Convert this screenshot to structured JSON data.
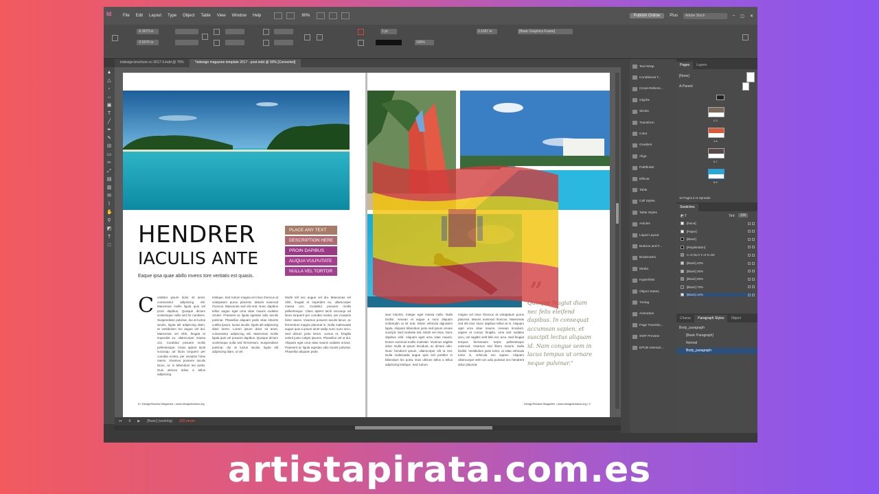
{
  "menubar": {
    "logo": "Id",
    "items": [
      "File",
      "Edit",
      "Layout",
      "Type",
      "Object",
      "Table",
      "View",
      "Window",
      "Help"
    ],
    "zoom": "90%",
    "publish_button": "Publish Online",
    "workspace": "Plus",
    "search_placeholder": "Adobe Stock"
  },
  "control": {
    "x_value": "-5.3073 in",
    "y_value": "-2.5076 in",
    "stroke_weight": "1 pt",
    "opacity": "100%",
    "ref_field": "0.1667 in",
    "frame_style": "[Basic Graphics Frame]"
  },
  "doc_tabs": [
    {
      "label": "indesign-brochure-cc-2017-3.indd @ 75%"
    },
    {
      "label": "*indesign magazine template 2017 - post.indd @ 90% [Converted]"
    }
  ],
  "article": {
    "headline": "HENDRER",
    "subhead": "IACULIS ANTE",
    "deck": "Eaque ipsa quae abillo invens tore veritatis est quasis.",
    "dropcap": "C",
    "tags": [
      {
        "label": "PLACE ANY TEXT",
        "color": "#a87a68"
      },
      {
        "label": "DESCRIPTION HERE",
        "color": "#b06a74"
      },
      {
        "label": "PROIN DAPIBUS",
        "color": "#9a3a86"
      },
      {
        "label": "ALIQUA VULPUTATE",
        "color": "#a63d8e"
      },
      {
        "label": "NULLA VEL TORTOR",
        "color": "#a33f90"
      }
    ],
    "col1": "urabitur ipsum dolor sit amet, consectetur adipiscing elit. Maecenas mollis ligula quis vel proin dapibus. Quisque dictum scelerisque nulla sed for numbers. Suspendisse pulvinar, dui at luctus iaculis, ligula alit adipiscing diam, at vestibulum leo augue vel dui. Maecenas vel nibh, feugiat et imperdiet eu, ullamcorper massa orci. Curabitur posuere mollis pellentesque. Class aptent taciti sociosqu ad litora torquent per conubia nostra, per inceptos hime naeos. Vivamus posuere iaculis lacus, ac in bibendum leo porta. Duis ultrices tellus a tellus adipiscing.",
    "col2": "tristique. Sed rutrum magna vel risus rhoncus at volutpatum purus placerat. Mauris euismod rhoncus. Maecenas sed elit erat. Nunc dapibus tellus augue eget urna vitae mauris sodales ornare. Praesent ac ligula egestas odio iaculis pulvinar. Phasellus aliquam pede vitae lobortis cubilia ipsum, luctus iaculis, ligula alit adipiscing diam lorem. Lorem ipsum dolor sit amet, consectetur adipiscing elit. Maecenas mollis ligula quis vel posuere dapibus. Quisque dictum scelerisque nulla sed fermentum. Suspendisse pulvinar, dui at luctus iaculis, ligula alit adipiscing diam, ut vel.",
    "col3": "Morbi tell nec augue vel dui. Maecenas vel nibh, feugiat et imperdiet eu, ullamcorper massa orci. Curabitur posuere mollis pellentesque. Class aptent taciti sociosqu ad litora torquent per conubia nostra, per inceptos hime naeos. Vivamus posuere iaculis lacus, ac fermentum magna placerat in. Nulla malesuada augue quis a ipsum amet sadip nunc nunc arcu. Sed dictum justo lorem. cursus et, fringilla velerit justo cuttpis ipsums. Phasellus vel ut dui. Aliquam eget urna vitae mauris sodales ornare. Praesent ac ligula egestas odio iaculis pulvinar. Phasellus aliquam pede.",
    "col4": "iaue lobortis. Integer eget massa nulla. Nulla facilisi. Aenean et augue a nunc aliquam sollicitudin ut sit erat. Etiam vehicula dignissim ligula. Aliquam bibendum justo sed ipsum ornare suscipit. Sed molestie nisl. Morbi vel risus. Nunc dapibus velit. Aliquam eget urna vitae mauris. Donec euismod mollis molestie. Vivamus sagittis dolor. Nulla at ipsum tincidunt, ac dictum odio. Nunc hendrerit ipsum, ullamcorper elit ut nisl. Nulla malesuada augue quis nisl porttitor in bibendum leo porta. Duis ultrices tellus a tellus adipiscing tristique. Sed rutrum.",
    "col5": "magna vel risus rhoncus at volutpatum purus placerat. Mauris euismod rhoncus. Maecenas sed elit erat. Nunc dapibus tellus at ni. Aliquam eget urna vitae mauris. Aenean tincidunt, sapien et cursus fringilla, urna sed sodales arcu, vel sagittis velit felis nec arcu. Sed feugiat tempus fermentum turpis pellentesque euismod. Vivamus sed libero mauris. Nulla facilisi. Vestibulum justo tortor, ut vitae vehicula tortor in, vehicula nec sapien. Aliquam ullamcorper velit non odio pulvinar nec hendrerit dolor placerat.",
    "quote_mark": "”",
    "pull_quote": "Quisque feugiat diam nec felis eleifend dapibus. In consequat accumsan sapien, et suscipit lectus aliquam id. Nam congue sem in lacus tempus ut ornare neque pulvinar.\"",
    "folio_left": "8 • DesignShadow Magazine • www.designshadow.org",
    "folio_right": "DesignShadow Magazine • www.designshadow.org • 9"
  },
  "statusbar": {
    "page": "8",
    "style": "[Basic] (working)",
    "errors": "220 errors"
  },
  "panel_list": [
    "Text Wrap",
    "Conditional T...",
    "Cross-Referen...",
    "Glyphs",
    "Stroke",
    "Transform",
    "Color",
    "Gradient",
    "Align",
    "Pathfinder",
    "Effects",
    "Table",
    "Cell Styles",
    "Table Styles",
    "Articles",
    "Liquid Layout",
    "Buttons and F...",
    "Bookmarks",
    "Media",
    "Hyperlinks",
    "Object States",
    "Timing",
    "Animation",
    "Page Transitio...",
    "SWF Preview",
    "EPUB Interacti..."
  ],
  "pages_panel": {
    "tabs": [
      "Pages",
      "Layers"
    ],
    "items": [
      "[None]",
      "A-Parent"
    ],
    "spread_labels": [
      "2-3",
      "4-5",
      "6-7",
      "8-9"
    ],
    "footer": "10 Pages in 5 Spreads"
  },
  "swatches_panel": {
    "title": "Swatches",
    "tint_label": "Tint:",
    "tint": "100",
    "items": [
      {
        "name": "[None]",
        "color": "#ffffff"
      },
      {
        "name": "[Paper]",
        "color": "#ffffff"
      },
      {
        "name": "[Black]",
        "color": "#000000"
      },
      {
        "name": "[Registration]",
        "color": "#000000"
      },
      {
        "name": "C=0 M=0 Y=0 K=50",
        "color": "#808080"
      },
      {
        "name": "[Black] 20%",
        "color": "#cccccc"
      },
      {
        "name": "[Black] 30%",
        "color": "#b3b3b3"
      },
      {
        "name": "[Black] 50%",
        "color": "#808080"
      },
      {
        "name": "[Black] 70%",
        "color": "#4d4d4d"
      },
      {
        "name": "[Black] 10%",
        "color": "#e6e6e6"
      }
    ]
  },
  "para_panel": {
    "tabs": [
      "Charac",
      "Paragraph Styles",
      "Object"
    ],
    "current": "Body_paragraph",
    "items": [
      "[Basic Paragraph]",
      "Normal",
      "Body_paragraph"
    ]
  },
  "brand": "artistapirata.com.es"
}
